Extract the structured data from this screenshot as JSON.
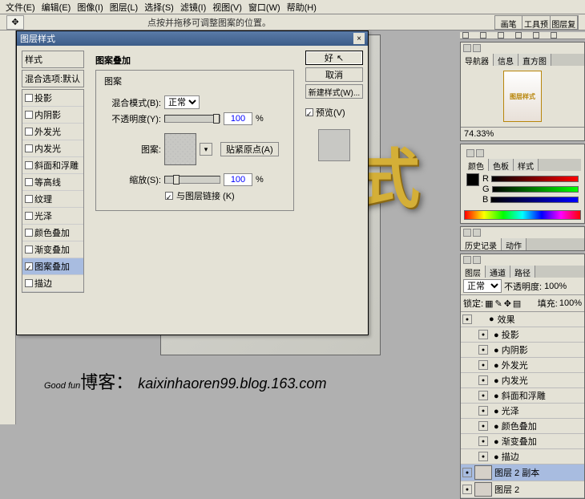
{
  "menu": [
    "文件(E)",
    "编辑(E)",
    "图像(I)",
    "图层(L)",
    "选择(S)",
    "滤镜(I)",
    "视图(V)",
    "窗口(W)",
    "帮助(H)"
  ],
  "hint": "点按并拖移可调整图案的位置。",
  "topTabs": [
    "画笔",
    "工具预设",
    "图层复合"
  ],
  "dialog": {
    "title": "图层样式",
    "styleHead": "样式",
    "blendDefault": "混合选项:默认",
    "items": [
      {
        "label": "投影",
        "on": false
      },
      {
        "label": "内阴影",
        "on": false
      },
      {
        "label": "外发光",
        "on": false
      },
      {
        "label": "内发光",
        "on": false
      },
      {
        "label": "斜面和浮雕",
        "on": false
      },
      {
        "label": "等高线",
        "on": false
      },
      {
        "label": "纹理",
        "on": false
      },
      {
        "label": "光泽",
        "on": false
      },
      {
        "label": "颜色叠加",
        "on": false
      },
      {
        "label": "渐变叠加",
        "on": false
      },
      {
        "label": "图案叠加",
        "on": true,
        "sel": true
      },
      {
        "label": "描边",
        "on": false
      }
    ],
    "section": "图案叠加",
    "subhead": "图案",
    "blendLabel": "混合模式(B):",
    "blendMode": "正常",
    "opacityLabel": "不透明度(Y):",
    "opacity": "100",
    "patternLabel": "图案:",
    "snapBtn": "贴紧原点(A)",
    "scaleLabel": "缩放(S):",
    "scale": "100",
    "linkLabel": "与图层链接 (K)",
    "pct": "%",
    "btns": {
      "ok": "好",
      "cancel": "取消",
      "newStyle": "新建样式(W)...",
      "preview": "预览(V)"
    }
  },
  "rightPanels": {
    "nav": {
      "tabs": [
        "导航器",
        "信息",
        "直方图"
      ],
      "thumbText": "图层样式",
      "zoom": "74.33%"
    },
    "color": {
      "tabs": [
        "颜色",
        "色板",
        "样式"
      ],
      "ch": [
        "R",
        "G",
        "B"
      ]
    },
    "history": {
      "tabs": [
        "历史记录",
        "动作"
      ]
    },
    "layers": {
      "tabs": [
        "图层",
        "通道",
        "路径"
      ],
      "mode": "正常",
      "opacityLabel": "不透明度:",
      "opacity": "100%",
      "lockLabel": "锁定:",
      "fillLabel": "填充:",
      "fill": "100%",
      "fxHead": "效果",
      "fx": [
        "投影",
        "内阴影",
        "外发光",
        "内发光",
        "斜面和浮雕",
        "光泽",
        "颜色叠加",
        "渐变叠加",
        "描边"
      ],
      "l1": "图层 2 副本",
      "l2": "图层 2"
    }
  },
  "watermark": {
    "a": "Good fun",
    "b": "博客：",
    "c": "kaixinhaoren99.blog.163.com"
  }
}
